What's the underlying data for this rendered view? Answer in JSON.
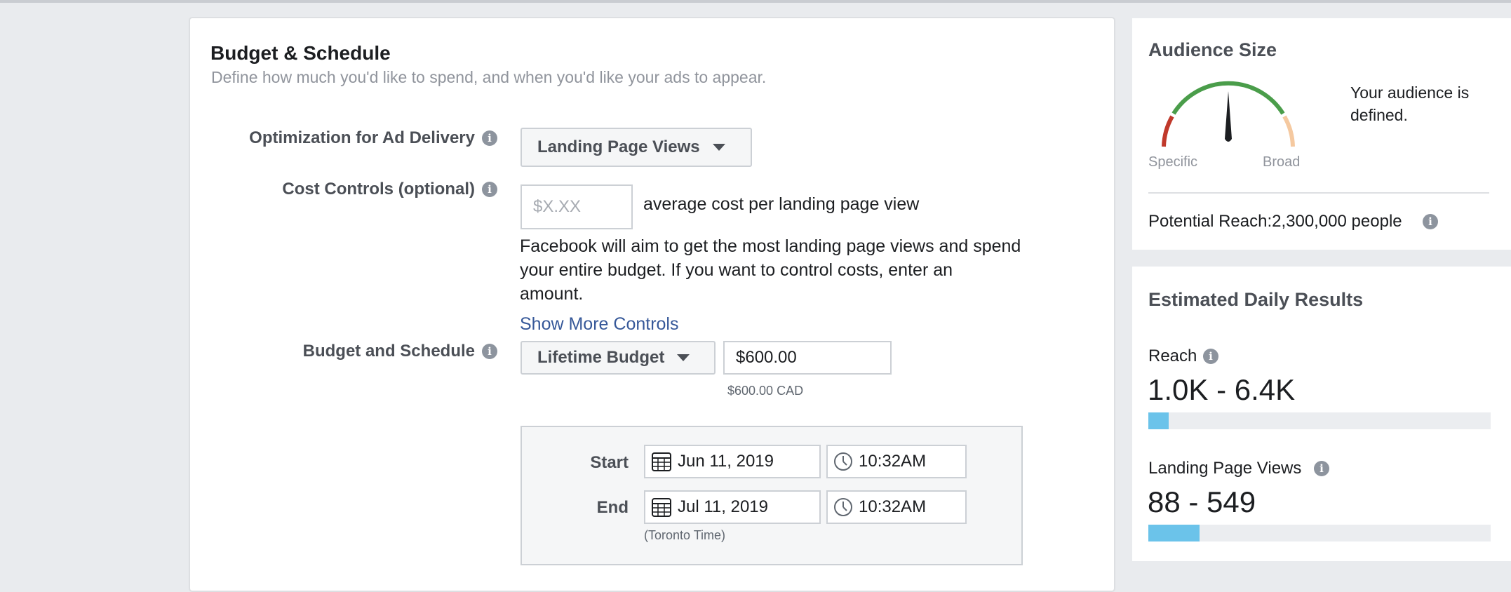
{
  "section": {
    "title": "Budget & Schedule",
    "subtitle": "Define how much you'd like to spend, and when you'd like your ads to appear."
  },
  "optimization": {
    "label": "Optimization for Ad Delivery",
    "selected": "Landing Page Views"
  },
  "cost_controls": {
    "label": "Cost Controls (optional)",
    "placeholder": "$X.XX",
    "suffix": "average cost per landing page view",
    "help_line1": "Facebook will aim to get the most landing page views and spend",
    "help_line2": "your entire budget. If you want to control costs, enter an",
    "help_line3": "amount.",
    "show_more": "Show More Controls"
  },
  "budget": {
    "label": "Budget and Schedule",
    "type": "Lifetime Budget",
    "amount": "$600.00",
    "amount_note": "$600.00 CAD"
  },
  "schedule": {
    "start_label": "Start",
    "start_date": "Jun 11, 2019",
    "start_time": "10:32AM",
    "end_label": "End",
    "end_date": "Jul 11, 2019",
    "end_time": "10:32AM",
    "timezone": "(Toronto Time)"
  },
  "audience": {
    "title": "Audience Size",
    "status_line1": "Your audience is",
    "status_line2": "defined.",
    "gauge_left": "Specific",
    "gauge_right": "Broad",
    "potential_reach": "Potential Reach:2,300,000 people",
    "colors": {
      "specific": "#c0392b",
      "defined": "#4a9d4a",
      "broad": "#f5c9a0",
      "needle": "#1c1e21"
    }
  },
  "estimates": {
    "title": "Estimated Daily Results",
    "reach_label": "Reach",
    "reach_value": "1.0K - 6.4K",
    "reach_fill_fraction": 0.06,
    "views_label": "Landing Page Views",
    "views_value": "88 - 549",
    "views_fill_fraction": 0.15,
    "bar_color": "#6bc3ea"
  }
}
